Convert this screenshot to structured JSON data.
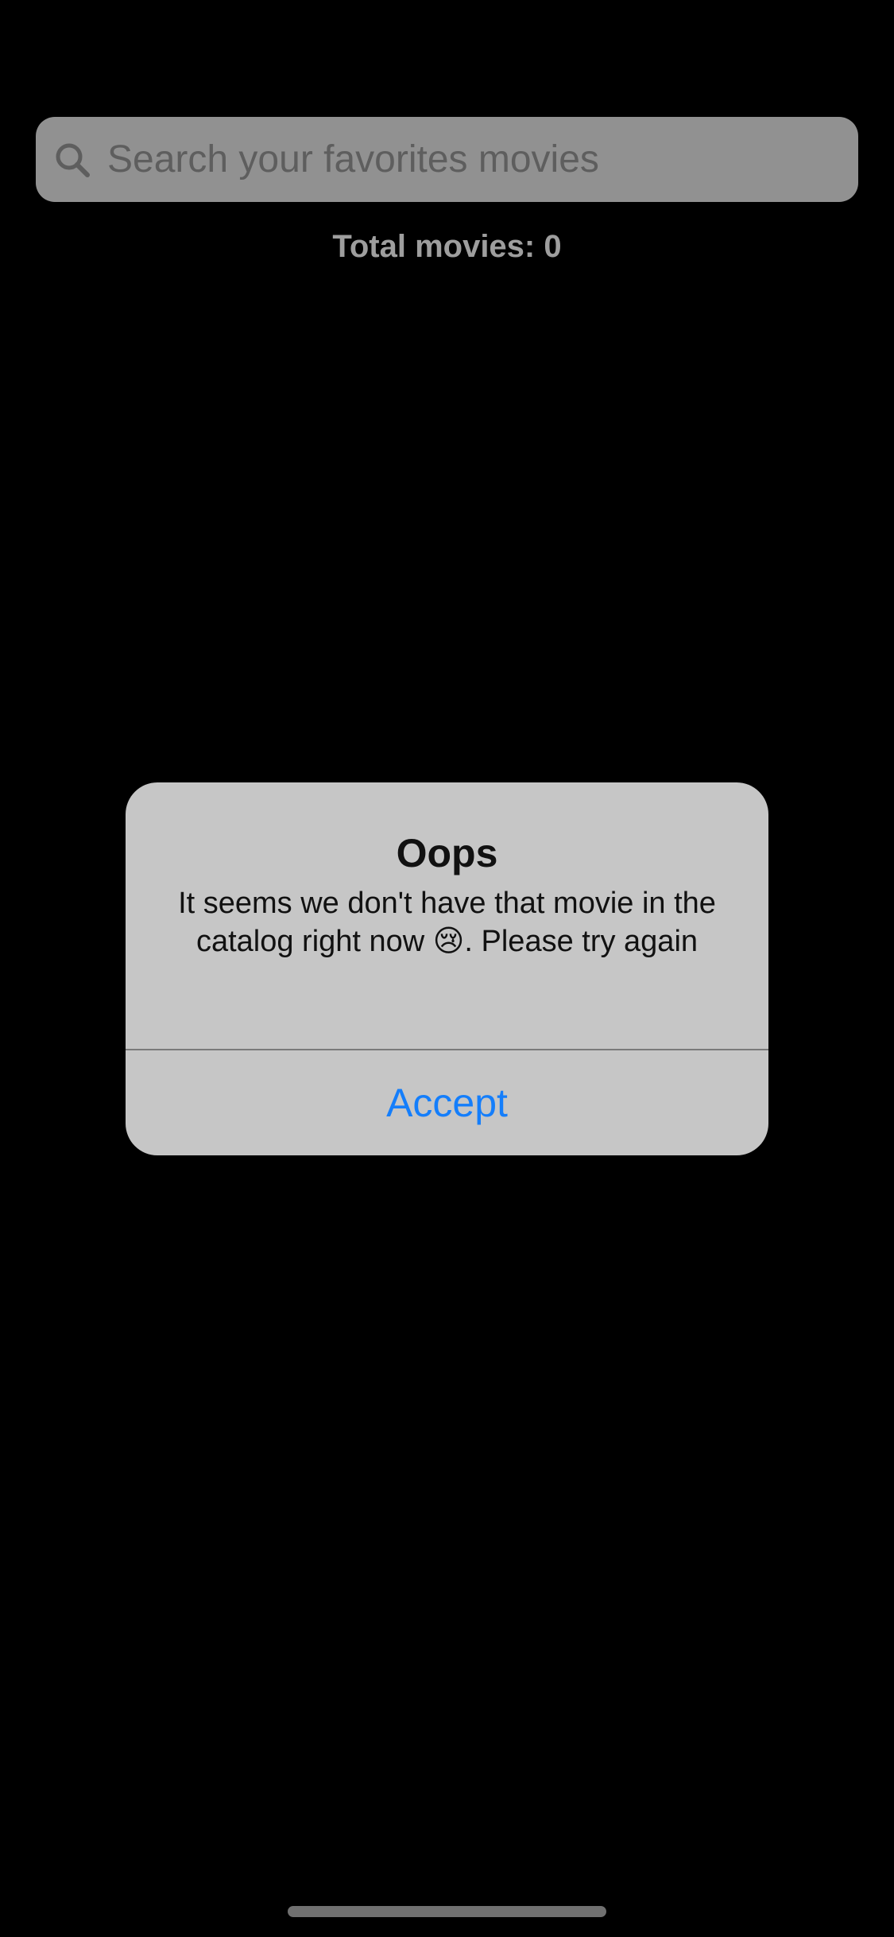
{
  "search": {
    "placeholder": "Search your favorites movies",
    "value": ""
  },
  "list": {
    "total_label": "Total movies: 0"
  },
  "alert": {
    "title": "Oops",
    "message": "It seems we don't have that movie in the catalog right now 😢. Please try again",
    "accept_label": "Accept"
  },
  "icons": {
    "search": "search-icon"
  },
  "colors": {
    "background": "#000000",
    "search_bar": "#919191",
    "alert_background": "#c6c6c6",
    "accent": "#147efb",
    "total_text": "#9e9e9e"
  }
}
